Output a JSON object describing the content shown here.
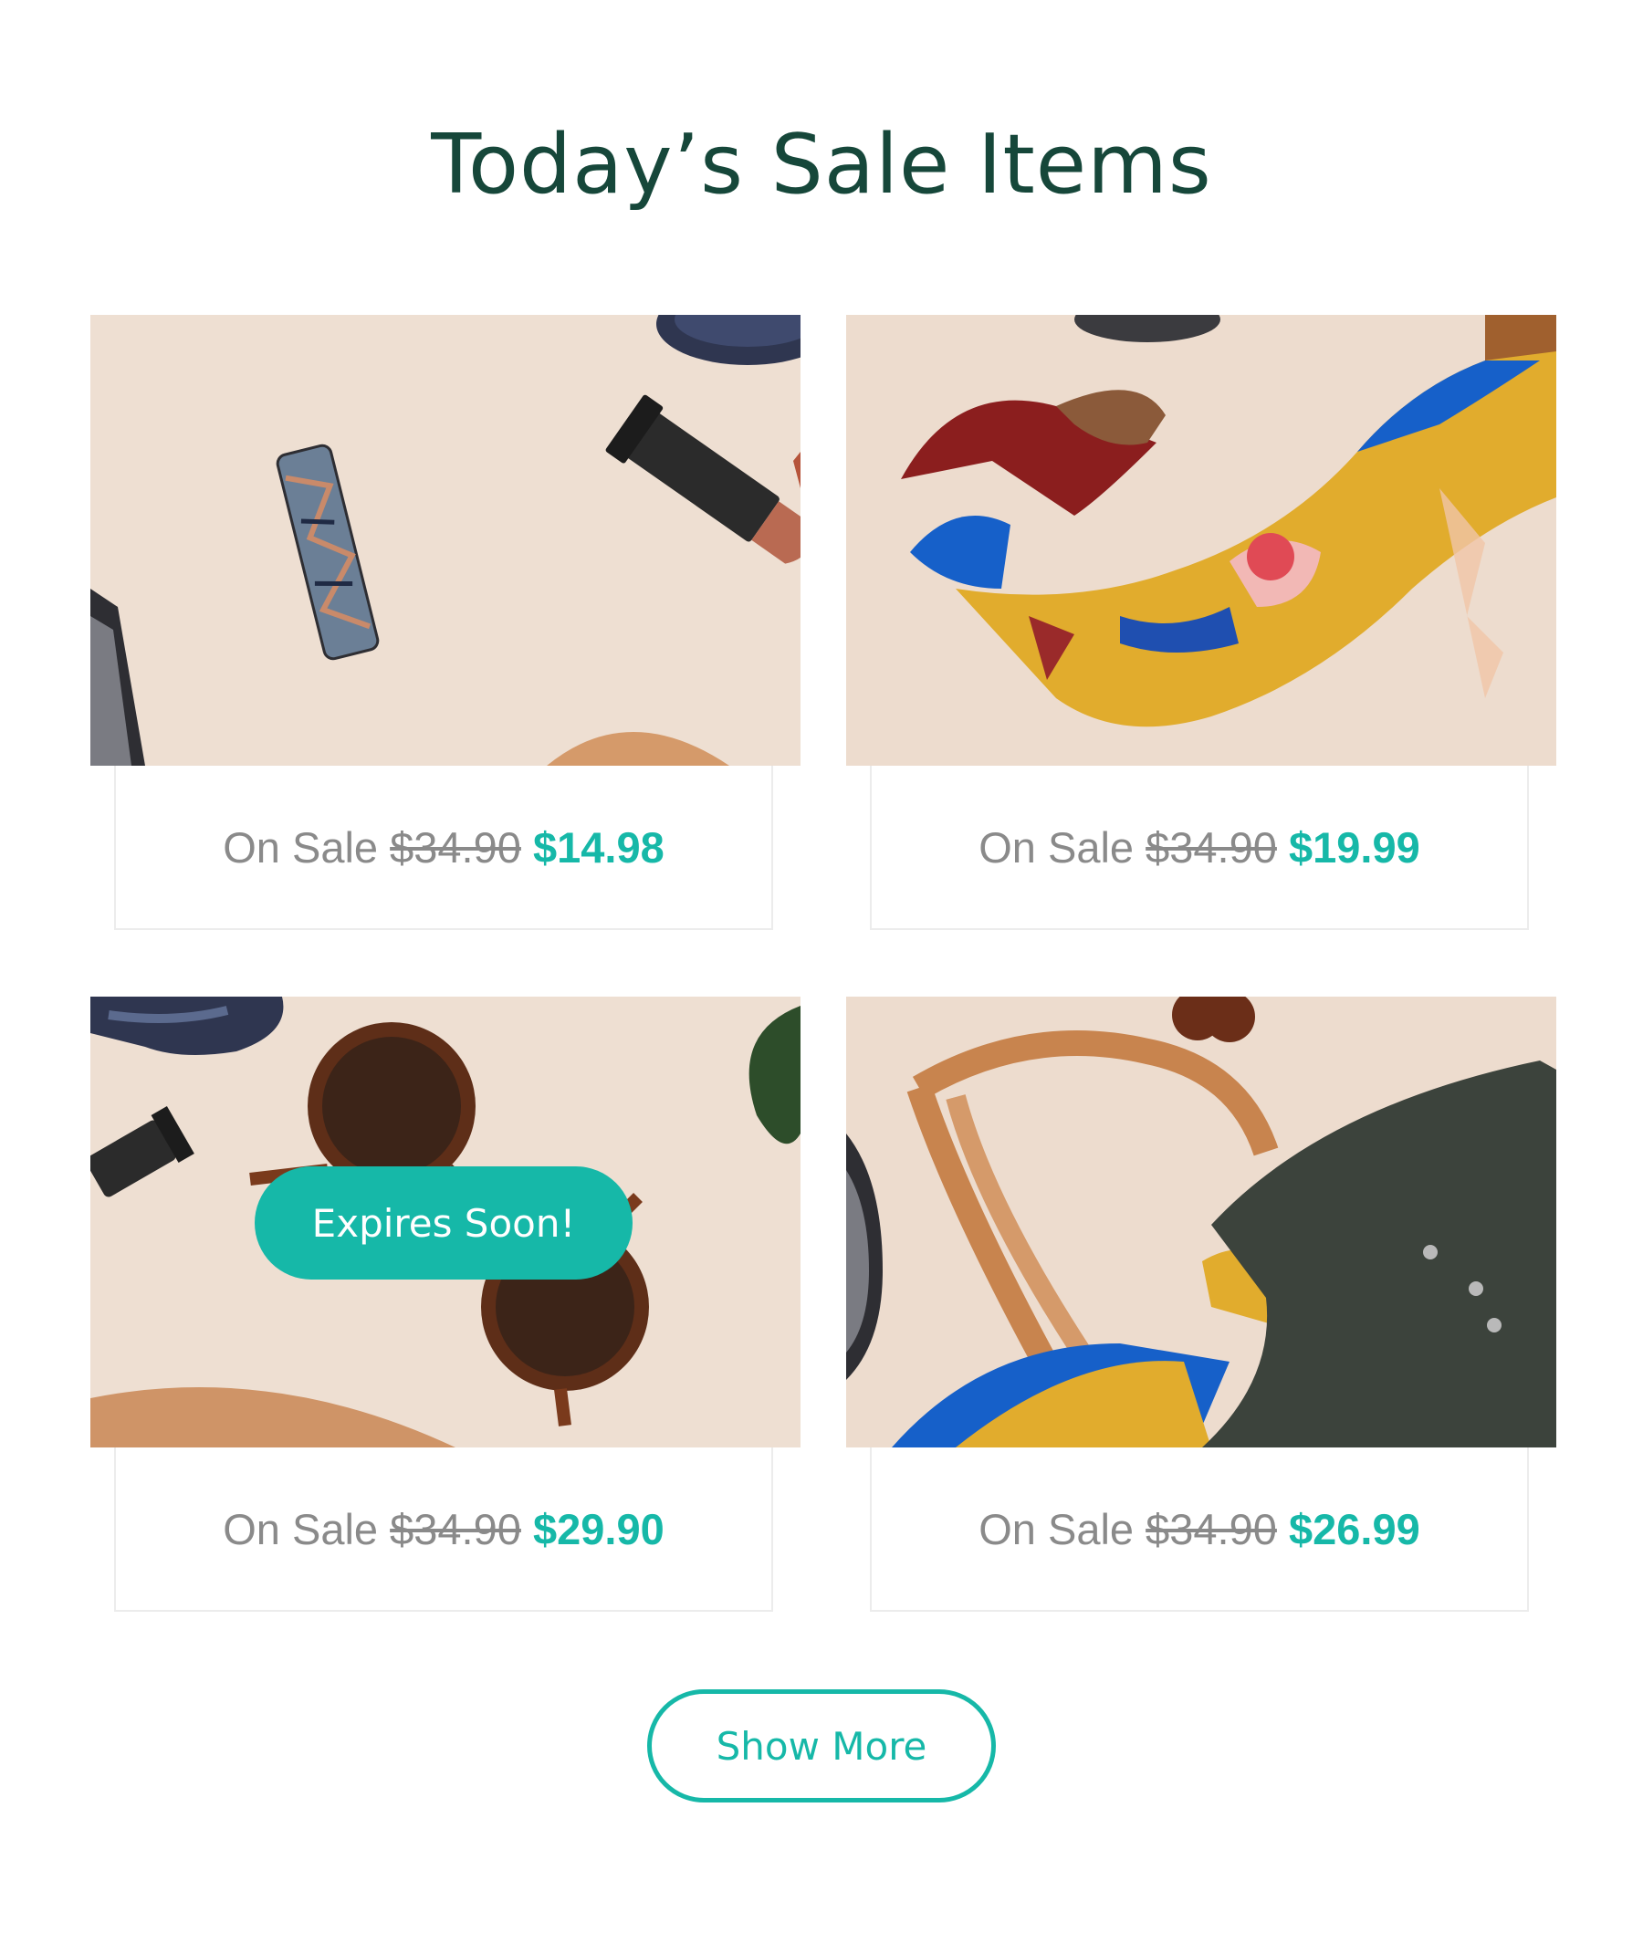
{
  "page": {
    "title": "Today’s Sale Items"
  },
  "products": [
    {
      "image": "lipstick-photo",
      "sale_label": "On Sale",
      "old_price": "$34.90",
      "new_price": "$14.98"
    },
    {
      "image": "silk-scarf-photo",
      "sale_label": "On Sale",
      "old_price": "$34.90",
      "new_price": "$19.99"
    },
    {
      "image": "sunglasses-photo",
      "sale_label": "On Sale",
      "old_price": "$34.90",
      "new_price": "$29.90",
      "badge": "Expires Soon!"
    },
    {
      "image": "leather-tote-photo",
      "sale_label": "On Sale",
      "old_price": "$34.90",
      "new_price": "$26.99"
    }
  ],
  "actions": {
    "show_more": "Show More"
  },
  "colors": {
    "heading": "#16473a",
    "accent": "#16b8a8",
    "muted": "#8a8a8a",
    "photo_background": "#eedfd2"
  }
}
